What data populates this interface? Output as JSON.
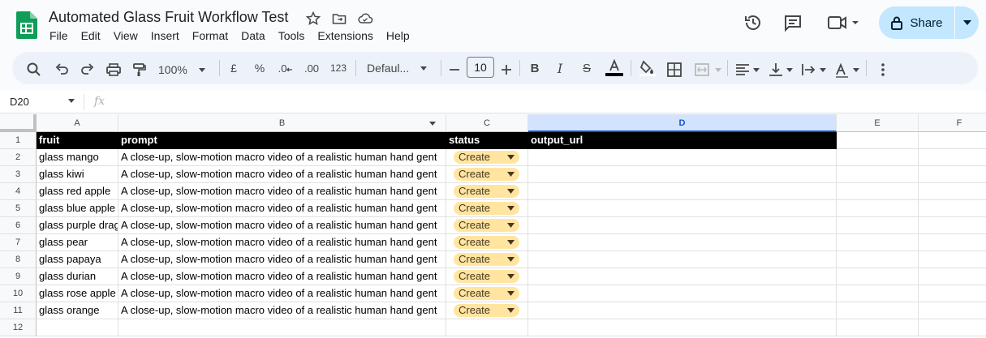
{
  "doc": {
    "title": "Automated Glass Fruit Workflow Test"
  },
  "menu": [
    "File",
    "Edit",
    "View",
    "Insert",
    "Format",
    "Data",
    "Tools",
    "Extensions",
    "Help"
  ],
  "header": {
    "share_label": "Share"
  },
  "toolbar": {
    "zoom": "100%",
    "currency": "£",
    "percent": "%",
    "decrease_decimal": ".0",
    "increase_decimal": ".00",
    "number_format": "123",
    "font": "Defaul...",
    "font_size": "10"
  },
  "formula_bar": {
    "name_box": "D20",
    "fx": "fx"
  },
  "columns": [
    "A",
    "B",
    "C",
    "D",
    "E",
    "F"
  ],
  "selected_column": "D",
  "rows": [
    "1",
    "2",
    "3",
    "4",
    "5",
    "6",
    "7",
    "8",
    "9",
    "10",
    "11",
    "12"
  ],
  "headers": {
    "a": "fruit",
    "b": "prompt",
    "c": "status",
    "d": "output_url"
  },
  "data_rows": [
    {
      "fruit": "glass mango",
      "prompt": "A close-up, slow-motion macro video of a realistic human hand gent",
      "status": "Create"
    },
    {
      "fruit": "glass kiwi",
      "prompt": "A close-up, slow-motion macro video of a realistic human hand gent",
      "status": "Create"
    },
    {
      "fruit": "glass red apple",
      "prompt": "A close-up, slow-motion macro video of a realistic human hand gent",
      "status": "Create"
    },
    {
      "fruit": "glass blue apple",
      "prompt": "A close-up, slow-motion macro video of a realistic human hand gent",
      "status": "Create"
    },
    {
      "fruit": "glass purple drag",
      "prompt": "A close-up, slow-motion macro video of a realistic human hand gent",
      "status": "Create"
    },
    {
      "fruit": "glass pear",
      "prompt": "A close-up, slow-motion macro video of a realistic human hand gent",
      "status": "Create"
    },
    {
      "fruit": "glass papaya",
      "prompt": "A close-up, slow-motion macro video of a realistic human hand gent",
      "status": "Create"
    },
    {
      "fruit": "glass durian",
      "prompt": "A close-up, slow-motion macro video of a realistic human hand gent",
      "status": "Create"
    },
    {
      "fruit": "glass rose apple",
      "prompt": "A close-up, slow-motion macro video of a realistic human hand gent",
      "status": "Create"
    },
    {
      "fruit": "glass orange",
      "prompt": "A close-up, slow-motion macro video of a realistic human hand gent",
      "status": "Create"
    }
  ],
  "colors": {
    "accent": "#0b57d0",
    "share_bg": "#c2e7ff",
    "chip_bg": "#ffe5a0",
    "header_row_bg": "#000000",
    "sheets_green": "#0f9d58"
  }
}
